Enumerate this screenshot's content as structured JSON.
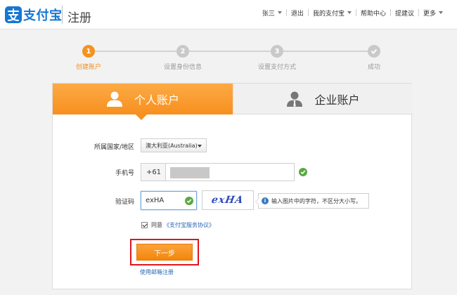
{
  "header": {
    "logo_text": "支付宝",
    "page_title": "注册",
    "nav": [
      {
        "label": "张三",
        "has_caret": true
      },
      {
        "label": "退出",
        "has_caret": false
      },
      {
        "label": "我的支付宝",
        "has_caret": true
      },
      {
        "label": "帮助中心",
        "has_caret": false
      },
      {
        "label": "提建议",
        "has_caret": false
      },
      {
        "label": "更多",
        "has_caret": true
      }
    ]
  },
  "steps": [
    {
      "number": "1",
      "label": "创建账户",
      "state": "active"
    },
    {
      "number": "2",
      "label": "设置身份信息",
      "state": "pending"
    },
    {
      "number": "3",
      "label": "设置支付方式",
      "state": "pending"
    },
    {
      "number": "",
      "label": "成功",
      "state": "pending"
    }
  ],
  "tabs": {
    "personal": "个人账户",
    "enterprise": "企业账户",
    "selected": "personal"
  },
  "form": {
    "country_label": "所属国家/地区",
    "country_value": "澳大利亚(Australia)",
    "phone_label": "手机号",
    "phone_prefix": "+61",
    "code_label": "验证码",
    "code_value": "exHA",
    "captcha_text": "exHA",
    "captcha_hint": "输入图片中的字符，不区分大小写。",
    "agree_prefix": "同意",
    "agree_link": "《支付宝服务协议》",
    "agree_checked": true,
    "next_button": "下一步",
    "email_link": "使用邮箱注册"
  },
  "colors": {
    "brand_orange": "#f7901f",
    "brand_blue": "#1677d3",
    "link_blue": "#2a67b1",
    "ok_green": "#5aa843",
    "highlight_red": "#e0141c"
  },
  "icons": {
    "logo": "alipay-logo-icon",
    "personal": "person-icon",
    "enterprise": "business-person-icon",
    "valid": "check-circle-icon",
    "hint": "info-icon",
    "caret": "chevron-down-icon"
  }
}
